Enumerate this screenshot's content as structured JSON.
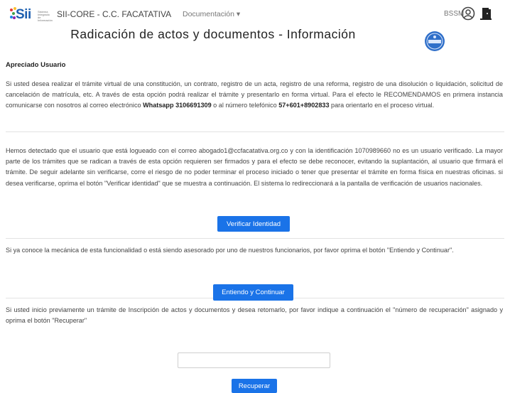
{
  "header": {
    "logo_text": "Sii",
    "logo_subtitle": "Sistema Integrado de Información",
    "app_title": "SII-CORE - C.C. FACATATIVA",
    "docs_menu": "Documentación ▾",
    "user": "BSSM",
    "icons": [
      "user-circle-icon",
      "exit-door-icon"
    ]
  },
  "page": {
    "title": "Radicación de actos y documentos - Información",
    "seal_icon": "blue-seal-badge"
  },
  "intro": {
    "greeting": "Apreciado Usuario",
    "p1_a": "Si usted desea realizar el trámite virtual de una constitución, un contrato, registro de un acta, registro de una reforma, registro de una disolución o liquidación, solicitud de cancelación de matrícula, etc. A través de esta opción podrá realizar el trámite y presentarlo en forma virtual. Para el efecto le RECOMENDAMOS en primera instancia comunicarse con nosotros al correo electrónico ",
    "p1_whatsapp": "Whatsapp 3106691309",
    "p1_b": " o al número telefónico ",
    "p1_phone": "57+601+8902833",
    "p1_c": " para orientarlo en el proceso virtual."
  },
  "verify": {
    "text": "Hemos detectado que el usuario que está logueado con el correo abogado1@ccfacatativa.org.co y con la identificación 1070989660 no es un usuario verificado. La mayor parte de los trámites que se radican a través de esta opción requieren ser firmados y para el efecto se debe reconocer, evitando la suplantación, al usuario que firmará el trámite. De seguir adelante sin verificarse, corre el riesgo de no poder terminar el proceso iniciado o tener que presentar el trámite en forma física en nuestras oficinas. si desea verificarse, oprima el botón \"Verificar identidad\" que se muestra a continuación. El sistema lo redireccionará a la pantalla de verificación de usuarios nacionales.",
    "button": "Verificar Identidad"
  },
  "continue": {
    "text": "Si ya conoce la mecánica de esta funcionalidad o está siendo asesorado por uno de nuestros funcionarios, por favor oprima el botón \"Entiendo y Continuar\".",
    "button": "Entiendo y Continuar"
  },
  "recover": {
    "text": "Si usted inicio previamente un trámite de Inscripción de actos y documentos y desea retomarlo, por favor indique a continuación el \"número de recuperación\" asignado y oprima el botón \"Recuperar\"",
    "input_value": "",
    "button": "Recuperar"
  }
}
